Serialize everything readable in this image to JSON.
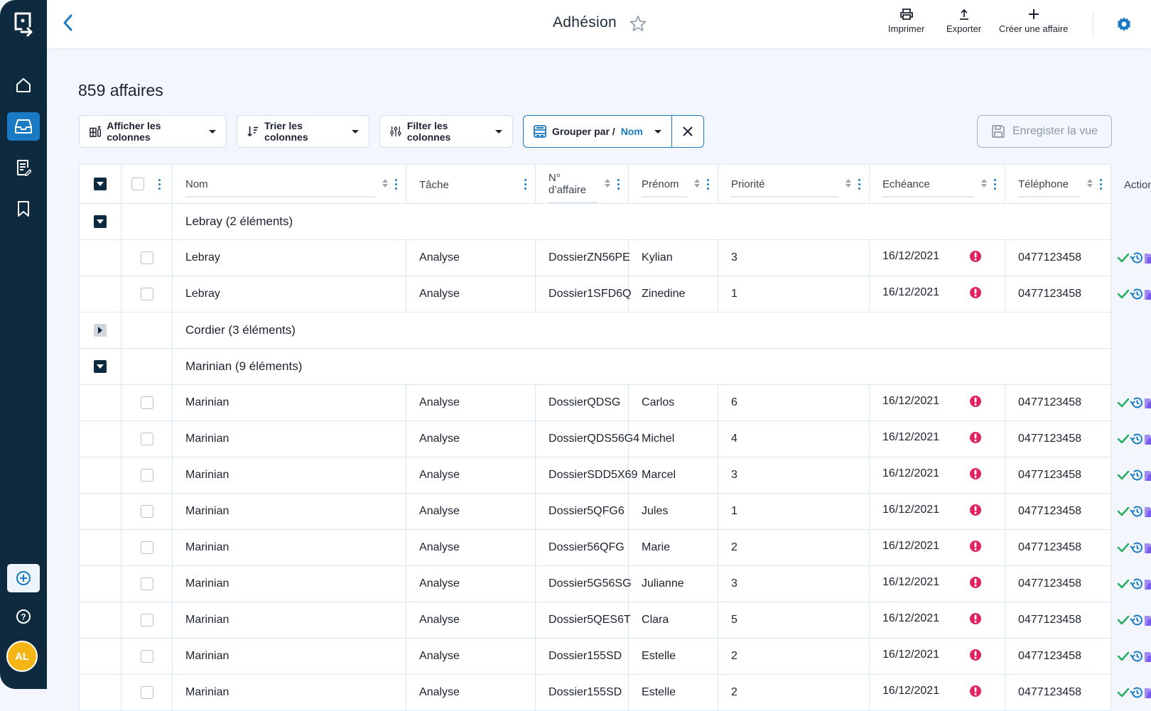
{
  "header": {
    "title": "Adhésion",
    "actions": [
      {
        "label": "Imprimer",
        "icon": "printer-icon"
      },
      {
        "label": "Exporter",
        "icon": "export-icon"
      },
      {
        "label": "Créer une affaire",
        "icon": "plus-icon"
      }
    ]
  },
  "sidebar": {
    "items": [
      "logo",
      "home",
      "inbox",
      "documents",
      "bookmarks",
      "add",
      "help"
    ],
    "avatar": "AL",
    "active": "inbox"
  },
  "main": {
    "count": "859 affaires",
    "toolbar": {
      "show_columns": "Afficher les colonnes",
      "sort_columns": "Trier les colonnes",
      "filter_columns": "Filter les colonnes",
      "group_by": "Grouper par /",
      "group_value": "Nom",
      "save_view": "Enregister la vue"
    },
    "columns": [
      "Nom",
      "Tâche",
      "N° d’affaire",
      "Prénom",
      "Priorité",
      "Echéance",
      "Téléphone",
      "Actions"
    ],
    "groups": [
      {
        "label": "Lebray (2 éléments)",
        "expanded": true,
        "rows": [
          {
            "nom": "Lebray",
            "tache": "Analyse",
            "num": "DossierZN56PE",
            "prenom": "Kylian",
            "prio": "3",
            "ech": "16/12/2021",
            "tel": "0477123458"
          },
          {
            "nom": "Lebray",
            "tache": "Analyse",
            "num": "Dossier1SFD6Q",
            "prenom": "Zinedine",
            "prio": "1",
            "ech": "16/12/2021",
            "tel": "0477123458"
          }
        ]
      },
      {
        "label": "Cordier (3 éléments)",
        "expanded": false,
        "rows": []
      },
      {
        "label": "Marinian  (9 éléments)",
        "expanded": true,
        "rows": [
          {
            "nom": "Marinian",
            "tache": "Analyse",
            "num": "DossierQDSG",
            "prenom": "Carlos",
            "prio": "6",
            "ech": "16/12/2021",
            "tel": "0477123458"
          },
          {
            "nom": "Marinian",
            "tache": "Analyse",
            "num": "DossierQDS56G4",
            "prenom": "Michel",
            "prio": "4",
            "ech": "16/12/2021",
            "tel": "0477123458"
          },
          {
            "nom": "Marinian",
            "tache": "Analyse",
            "num": "DossierSDD5X69",
            "prenom": "Marcel",
            "prio": "3",
            "ech": "16/12/2021",
            "tel": "0477123458"
          },
          {
            "nom": "Marinian",
            "tache": "Analyse",
            "num": "Dossier5QFG6",
            "prenom": "Jules",
            "prio": "1",
            "ech": "16/12/2021",
            "tel": "0477123458"
          },
          {
            "nom": "Marinian",
            "tache": "Analyse",
            "num": "Dossier56QFG",
            "prenom": "Marie",
            "prio": "2",
            "ech": "16/12/2021",
            "tel": "0477123458"
          },
          {
            "nom": "Marinian",
            "tache": "Analyse",
            "num": "Dossier5G56SG",
            "prenom": "Julianne",
            "prio": "3",
            "ech": "16/12/2021",
            "tel": "0477123458"
          },
          {
            "nom": "Marinian",
            "tache": "Analyse",
            "num": "Dossier5QES6T",
            "prenom": "Clara",
            "prio": "5",
            "ech": "16/12/2021",
            "tel": "0477123458"
          },
          {
            "nom": "Marinian",
            "tache": "Analyse",
            "num": "Dossier155SD",
            "prenom": "Estelle",
            "prio": "2",
            "ech": "16/12/2021",
            "tel": "0477123458"
          },
          {
            "nom": "Marinian",
            "tache": "Analyse",
            "num": "Dossier155SD",
            "prenom": "Estelle",
            "prio": "2",
            "ech": "16/12/2021",
            "tel": "0477123458"
          }
        ]
      }
    ]
  },
  "colors": {
    "accent": "#1a7ac4",
    "sidebar": "#0e2a3f",
    "alert": "#e0245e",
    "check": "#27ae60",
    "folder": "#7b5cf0",
    "avatar": "#f5b514"
  }
}
